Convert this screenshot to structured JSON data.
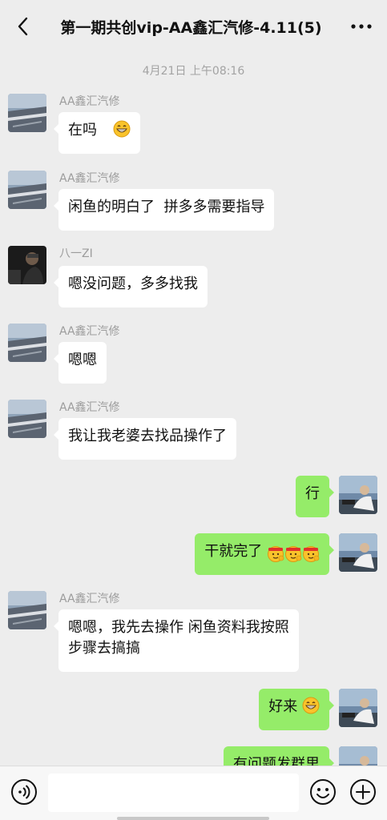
{
  "header": {
    "title": "第一期共创vip-AA鑫汇汽修-4.11(5)",
    "back_icon": "chevron-left-icon",
    "more_icon": "more-dots-icon"
  },
  "chat": {
    "timestamp": "4月21日 上午08:16",
    "messages": [
      {
        "sender": "AA鑫汇汽修",
        "text": "在吗",
        "emoji": "grin-emoji",
        "side": "left"
      },
      {
        "sender": "AA鑫汇汽修",
        "text": "闲鱼的明白了  拼多多需要指导",
        "side": "left"
      },
      {
        "sender": "八一ZI",
        "text": "嗯没问题，多多找我",
        "side": "left"
      },
      {
        "sender": "AA鑫汇汽修",
        "text": "嗯嗯",
        "side": "left"
      },
      {
        "sender": "AA鑫汇汽修",
        "text": "我让我老婆去找品操作了",
        "side": "left"
      },
      {
        "text": "行",
        "side": "right"
      },
      {
        "text": "干就完了",
        "emoji": "fighting-emoji-x3",
        "side": "right"
      },
      {
        "sender": "AA鑫汇汽修",
        "line1": "嗯嗯，我先去操作 闲鱼资料我按照",
        "line2": "步骤去搞搞",
        "side": "left"
      },
      {
        "text": "好来",
        "emoji": "grin-emoji",
        "side": "right"
      },
      {
        "text": "有问题发群里",
        "side": "right"
      }
    ]
  },
  "footer": {
    "voice_icon": "voice-icon",
    "emoji_icon": "smiley-icon",
    "plus_icon": "plus-icon"
  },
  "colors": {
    "background": "#ededed",
    "outgoing_bubble": "#95ec69",
    "incoming_bubble": "#ffffff",
    "name_text": "#9c9c9c"
  }
}
